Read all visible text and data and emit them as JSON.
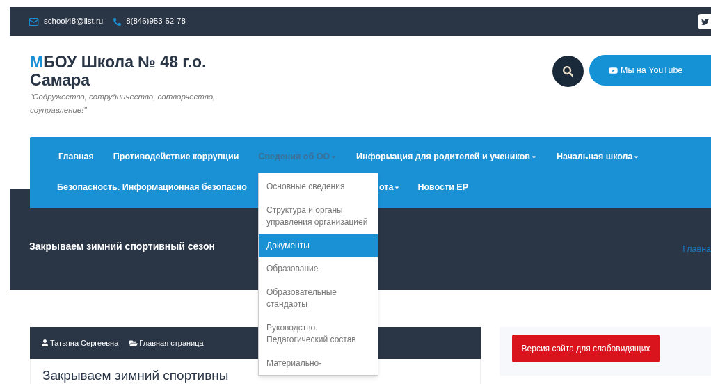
{
  "top_bar": {
    "email": "school48@list.ru",
    "phone": "8(846)953-52-78"
  },
  "header": {
    "title_initial": "М",
    "title_rest": "БОУ Школа № 48 г.о. Самара",
    "tagline": "\"Содружество, сотрудничество, сотворчество, соуправление!\"",
    "youtube_button": "Мы на YouTube"
  },
  "nav": {
    "primary": [
      {
        "label": "Главная",
        "has_menu": false,
        "selected": false
      },
      {
        "label": "Противодействие коррупции",
        "has_menu": false,
        "selected": false
      },
      {
        "label": "Сведения об ОО",
        "has_menu": true,
        "selected": true
      },
      {
        "label": "Информация для родителей и учеников",
        "has_menu": true,
        "selected": false
      },
      {
        "label": "Начальная школа",
        "has_menu": true,
        "selected": false
      }
    ],
    "secondary": [
      {
        "label": "Безопасность. Информационная безопасно",
        "has_menu": false,
        "selected": false
      },
      {
        "label": "ота",
        "has_menu": true,
        "selected": false
      },
      {
        "label": "Новости ЕР",
        "has_menu": false,
        "selected": false
      }
    ]
  },
  "dropdown": [
    {
      "label": "Основные сведения",
      "selected": false
    },
    {
      "label": "Структура и органы управления организацией",
      "selected": false
    },
    {
      "label": "Документы",
      "selected": true
    },
    {
      "label": "Образование",
      "selected": false
    },
    {
      "label": "Образовательные стандарты",
      "selected": false
    },
    {
      "label": "Руководство. Педагогический состав",
      "selected": false
    },
    {
      "label": "Материально-",
      "selected": false
    }
  ],
  "banner": {
    "title": "Закрываем зимний спортивный сезон",
    "breadcrumb": "Главна"
  },
  "article": {
    "author": "Татьяна Сергеевна",
    "category": "Главная страница",
    "title": "Закрываем зимний спортивны"
  },
  "sidebar": {
    "accessibility_button": "Версия сайта для слабовидящих"
  }
}
